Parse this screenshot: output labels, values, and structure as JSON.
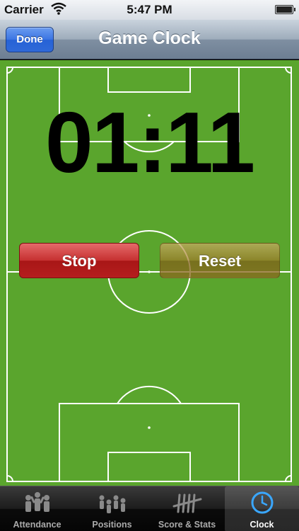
{
  "status_bar": {
    "carrier": "Carrier",
    "time": "5:47 PM"
  },
  "nav_bar": {
    "title": "Game Clock",
    "done_label": "Done"
  },
  "clock": {
    "display": "01:11"
  },
  "controls": {
    "stop_label": "Stop",
    "reset_label": "Reset"
  },
  "tab_bar": {
    "tabs": [
      {
        "label": "Attendance",
        "icon": "people-icon"
      },
      {
        "label": "Positions",
        "icon": "positions-icon"
      },
      {
        "label": "Score & Stats",
        "icon": "tally-icon"
      },
      {
        "label": "Clock",
        "icon": "clock-icon"
      }
    ],
    "active_index": 3
  },
  "colors": {
    "field_green": "#5aa52d",
    "stop_red": "#b51e1e",
    "done_blue": "#2f69d8"
  }
}
